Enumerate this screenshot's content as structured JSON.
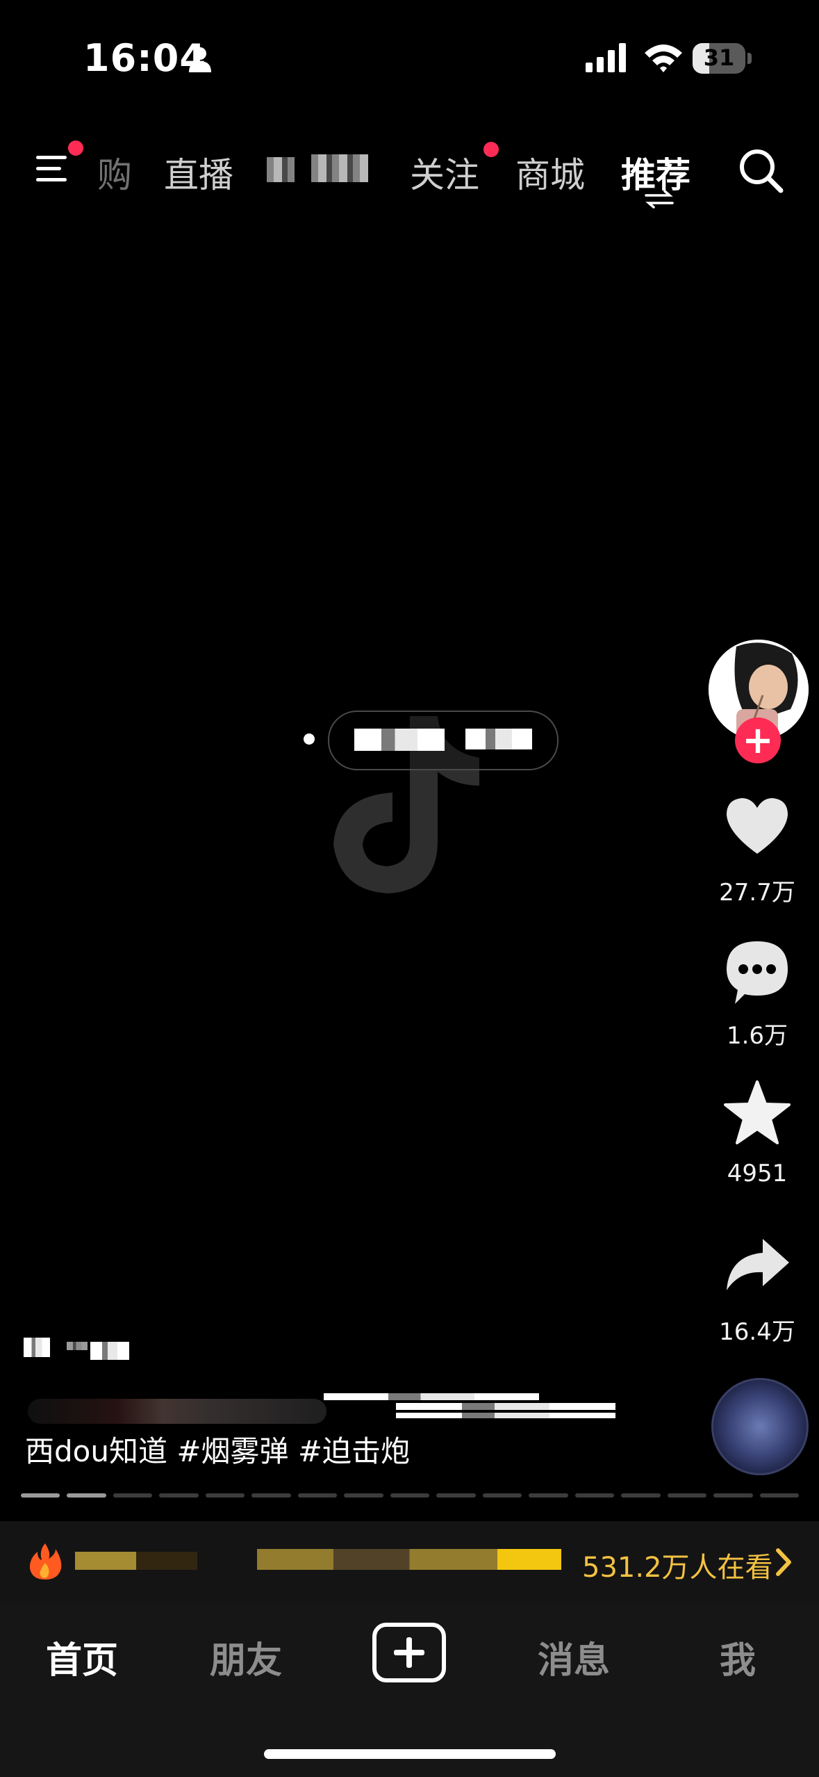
{
  "status_bar": {
    "time": "16:04",
    "battery": "31",
    "battery_level": 0.31
  },
  "top_nav": {
    "tabs": [
      {
        "label": "购"
      },
      {
        "label": "直播"
      },
      {
        "label": "关注"
      },
      {
        "label": "商城"
      },
      {
        "label": "推荐"
      }
    ]
  },
  "right_rail": {
    "likes": "27.7万",
    "comments": "1.6万",
    "favorites": "4951",
    "shares": "16.4万"
  },
  "video": {
    "caption": "西dou知道 #烟雾弹 #迫击炮",
    "progress_segments": 17,
    "progress_done": 2
  },
  "live_banner": {
    "viewers_text": "531.2万人在看"
  },
  "bottom_tabs": {
    "home": "首页",
    "friends": "朋友",
    "messages": "消息",
    "me": "我"
  },
  "colors": {
    "accent_red": "#fe2c55",
    "live_gold": "#f3c242",
    "background": "#000000"
  }
}
